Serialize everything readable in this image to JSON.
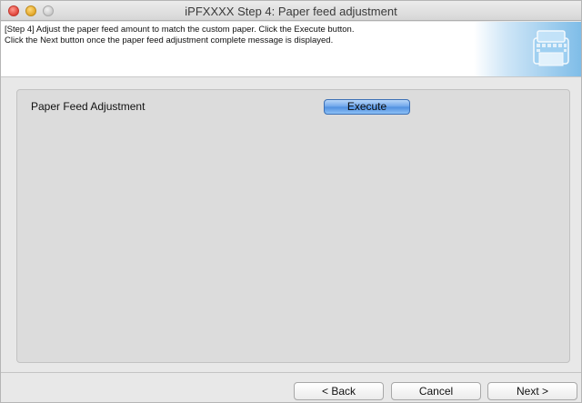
{
  "window": {
    "title": "iPFXXXX Step 4: Paper feed adjustment"
  },
  "header": {
    "instructions_line1": "[Step 4] Adjust the paper feed amount to match the custom paper. Click the Execute button.",
    "instructions_line2": "Click the Next button once the paper feed adjustment complete message is displayed.",
    "graphic_icon": "printer-graphic"
  },
  "panel": {
    "row_label": "Paper Feed Adjustment",
    "execute_label": "Execute"
  },
  "footer": {
    "back_label": "< Back",
    "cancel_label": "Cancel",
    "next_label": "Next >"
  },
  "colors": {
    "accent": "#5a97e4",
    "panel": "#dcdcdc"
  }
}
